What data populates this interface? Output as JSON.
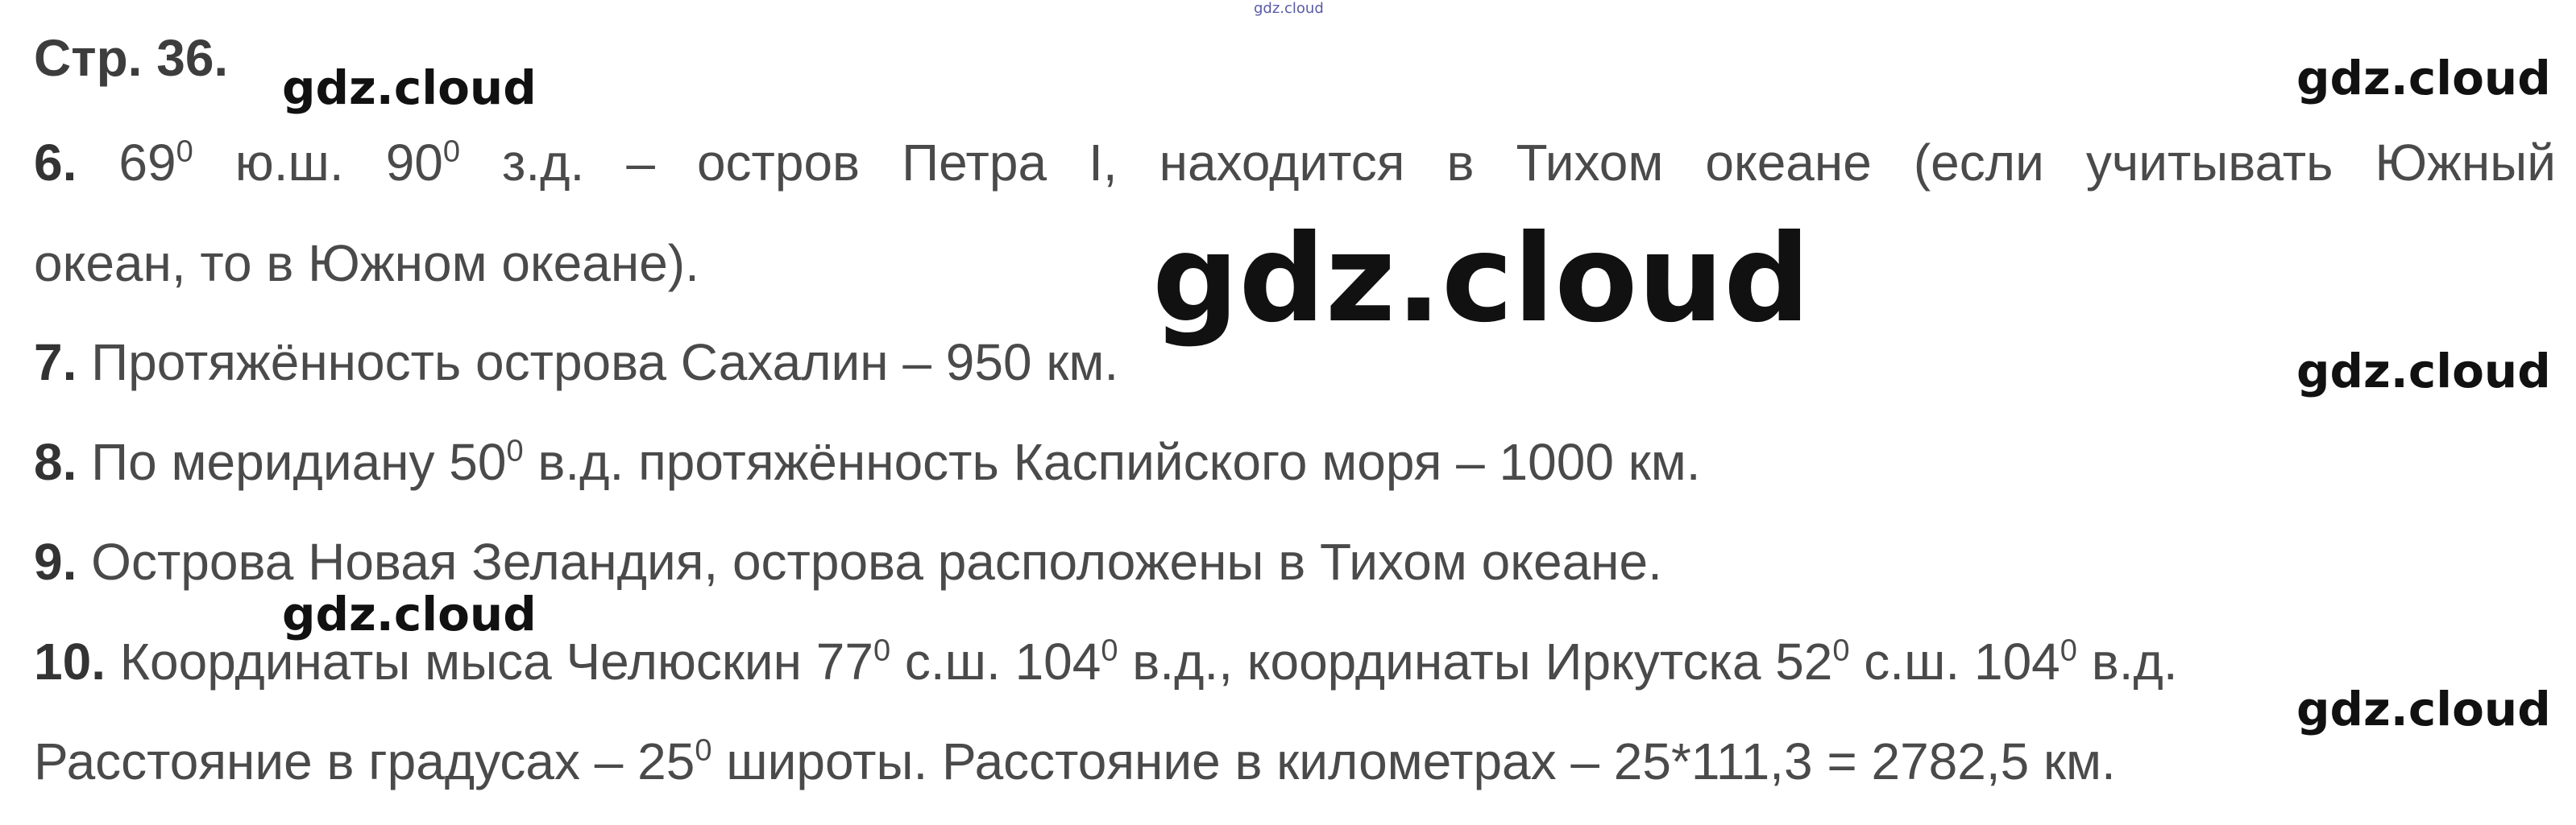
{
  "header": {
    "page_label": "Стр. 36."
  },
  "answers": [
    {
      "number": "6.",
      "parts": [
        "69",
        "0",
        " ю.ш. 90",
        "0",
        " з.д. – остров Петра I, находится в Тихом океане (если учитывать Южный"
      ],
      "continuation": "океан, то в Южном океане)."
    },
    {
      "number": "7.",
      "text": "Протяжённость острова Сахалин – 950 км."
    },
    {
      "number": "8.",
      "parts": [
        "По меридиану 50",
        "0",
        " в.д. протяжённость Каспийского моря – 1000 км."
      ]
    },
    {
      "number": "9.",
      "text": "Острова Новая Зеландия, острова расположены в Тихом океане."
    },
    {
      "number": "10.",
      "parts": [
        "Координаты мыса Челюскин 77",
        "0",
        " с.ш. 104",
        "0",
        " в.д., координаты Иркутска 52",
        "0",
        " с.ш. 104",
        "0",
        " в.д."
      ],
      "continuation_parts": [
        "Расстояние в градусах – 25",
        "0",
        " широты. Расстояние в километрах – 25*111,3 = 2782,5 км."
      ]
    }
  ],
  "watermarks": {
    "tiny": "gdz.cloud",
    "small": "gdz.cloud",
    "big": "gdz.cloud"
  }
}
